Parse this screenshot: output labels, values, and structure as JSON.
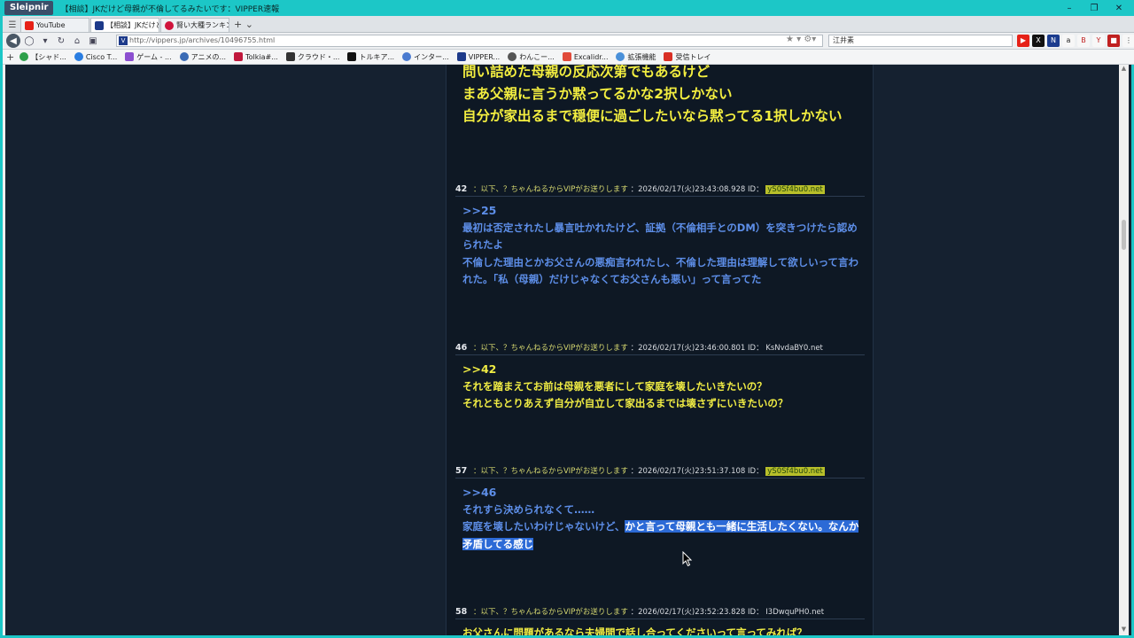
{
  "window": {
    "app_name": "Sleipnir",
    "title": "【相談】JKだけど母親が不倫してるみたいです：VIPPER速報",
    "controls": [
      "–",
      "❐",
      "✕"
    ]
  },
  "tabs": [
    {
      "label": "YouTube",
      "color": "#e62117",
      "active": false
    },
    {
      "label": "【相談】JKだけど...",
      "color": "#1d3a8a",
      "active": true
    },
    {
      "label": "腎い大種ランキン...",
      "color": "#d0143c",
      "active": false
    }
  ],
  "address": {
    "url": "http://vippers.jp/archives/10496755.html",
    "favicon_letter": "V",
    "search_value": "江井素"
  },
  "bookmarks": [
    {
      "label": "【シャド...",
      "color": "#2ea04a"
    },
    {
      "label": "Cisco T...",
      "color": "#2a7de1"
    },
    {
      "label": "ゲーム - ...",
      "color": "#8c4fd0"
    },
    {
      "label": "アニメの...",
      "color": "#3b6bb5"
    },
    {
      "label": "Tolkia#...",
      "color": "#c0183c"
    },
    {
      "label": "クラウド・...",
      "color": "#333333"
    },
    {
      "label": "トルキア...",
      "color": "#111111"
    },
    {
      "label": "インター...",
      "color": "#4a7bd0"
    },
    {
      "label": "VIPPER...",
      "color": "#1d3a8a"
    },
    {
      "label": "わんこー...",
      "color": "#555555"
    },
    {
      "label": "Excalidr...",
      "color": "#e14b3b"
    },
    {
      "label": "拡張機能",
      "color": "#4a90d9"
    },
    {
      "label": "受信トレイ",
      "color": "#d93025"
    }
  ],
  "posts_top": [
    "問い詰めた母親の反応次第でもあるけど",
    "まあ父親に言うか黙ってるかな2択しかない",
    "自分が家出るまで穏便に過ごしたいなら黙ってる1択しかない"
  ],
  "posts": [
    {
      "number": "42",
      "name": "：以下、？ちゃんねるからVIPがお送りします",
      "datetime": "：2026/02/17(火)23:43:08.928 ID：",
      "id": "yS0Sf4bu0.net",
      "id_highlight": true,
      "color": "blue",
      "anchor": ">>25",
      "lines": [
        "最初は否定されたし暴言吐かれたけど、証拠（不倫相手とのDM）を突きつけたら認められたよ",
        "不倫した理由とかお父さんの悪痴言われたし、不倫した理由は理解して欲しいって言われた。「私（母親）だけじゃなくてお父さんも悪い」って言ってた"
      ]
    },
    {
      "number": "46",
      "name": "：以下、？ちゃんねるからVIPがお送りします",
      "datetime": "：2026/02/17(火)23:46:00.801 ID：",
      "id": "KsNvdaBY0.net",
      "id_highlight": false,
      "color": "yellow",
      "anchor": ">>42",
      "lines": [
        "それを踏まえてお前は母親を悪者にして家庭を壊したいきたいの？",
        "それともとりあえず自分が自立して家出るまでは壊さずにいきたいの？"
      ]
    },
    {
      "number": "57",
      "name": "：以下、？ちゃんねるからVIPがお送りします",
      "datetime": "：2026/02/17(火)23:51:37.108 ID：",
      "id": "yS0Sf4bu0.net",
      "id_highlight": true,
      "color": "blue",
      "anchor": ">>46",
      "line1": "それすら決められなくて……",
      "line2_plain": "家庭を壊したいわけじゃないけど、",
      "line2_selected": "かと言って母親とも一緒に生活したくない。なんか矛盾してる感じ"
    },
    {
      "number": "58",
      "name": "：以下、？ちゃんねるからVIPがお送りします",
      "datetime": "：2026/02/17(火)23:52:23.828 ID：",
      "id": "I3DwquPH0.net",
      "id_highlight": false,
      "color": "yellow",
      "partial_line": "お父さんに問題があるなら夫婦間で話し合ってくださいって言ってみれば？"
    }
  ]
}
